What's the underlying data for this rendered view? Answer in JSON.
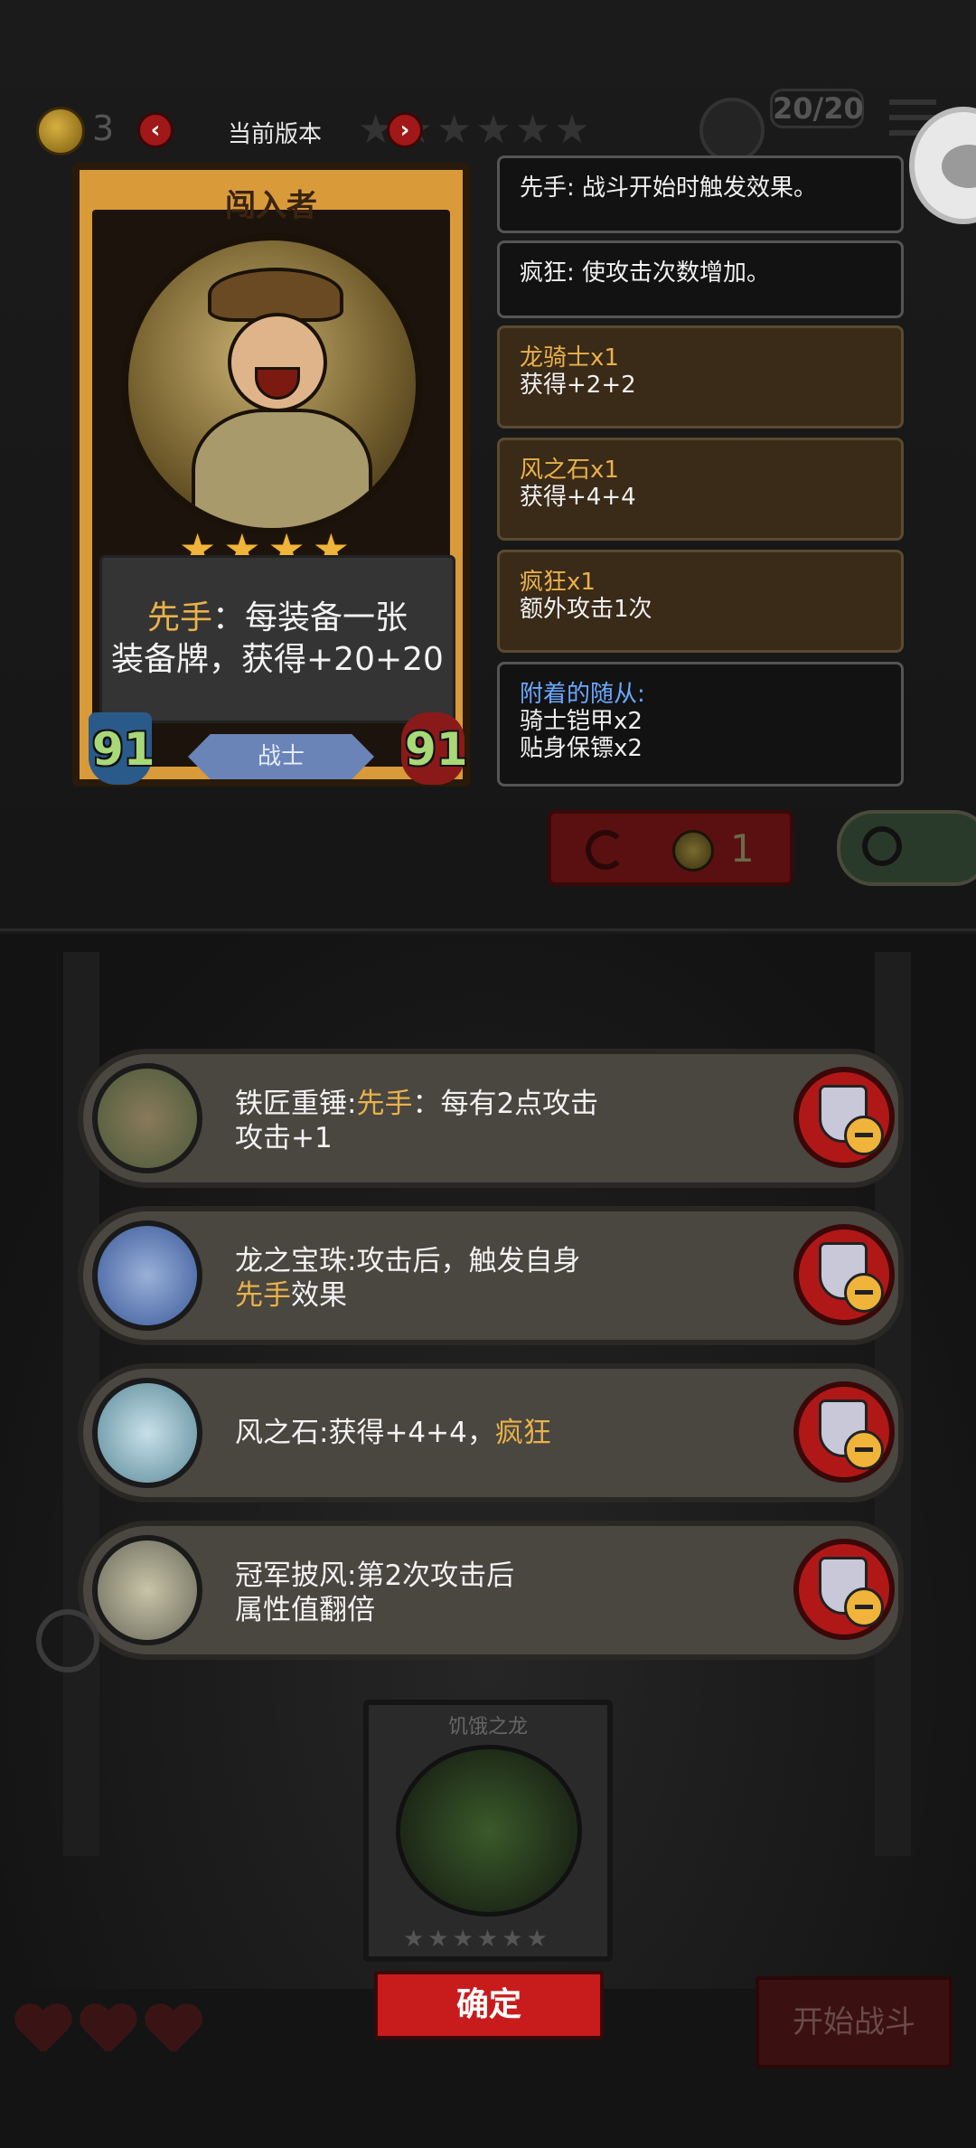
{
  "top": {
    "coin_count": "3",
    "version_label": "当前版本",
    "version_stars": "★★★★★★",
    "troop_count": "20/20",
    "prev_icon": "chevron-left-icon",
    "next_icon": "chevron-right-icon"
  },
  "hero": {
    "name": "闯入者",
    "stars": "★★★★",
    "desc_keyword": "先手",
    "desc_line1_rest": "：每装备一张",
    "desc_line2": "装备牌，获得+20+20",
    "attack": "91",
    "health": "91",
    "class": "战士"
  },
  "effects": {
    "first_strike": "先手: 战斗开始时触发效果。",
    "frenzy": "疯狂: 使攻击次数增加。",
    "bonus1_title": "龙骑士x1",
    "bonus1_value": "获得+2+2",
    "bonus2_title": "风之石x1",
    "bonus2_value": "获得+4+4",
    "bonus3_title": "疯狂x1",
    "bonus3_value": "额外攻击1次",
    "minions_title": "附着的随从:",
    "minion1": "骑士铠甲x2",
    "minion2": "贴身保镖x2"
  },
  "reroll": {
    "cost": "1"
  },
  "equipment": [
    {
      "prefix": "铁匠重锤:",
      "keyword": "先手",
      "suffix": "：每有2点攻击",
      "line2": "攻击+1",
      "icon": "anvil-icon"
    },
    {
      "prefix": "龙之宝珠:攻击后，触发自身",
      "line2_keyword": "先手",
      "line2_rest": "效果",
      "icon": "dragon-orb-icon"
    },
    {
      "prefix": "风之石:获得+4+4，",
      "keyword": "疯狂",
      "icon": "wind-stone-icon"
    },
    {
      "prefix": "冠军披风:第2次攻击后",
      "line2": "属性值翻倍",
      "icon": "cape-icon"
    }
  ],
  "dragon_card": {
    "name": "饥饿之龙",
    "stars": "★★★★★★"
  },
  "buttons": {
    "confirm": "确定",
    "start_battle": "开始战斗"
  },
  "colors": {
    "keyword": "#e8b24a",
    "accent_red": "#c81c1c",
    "panel_bg": "#121212"
  }
}
